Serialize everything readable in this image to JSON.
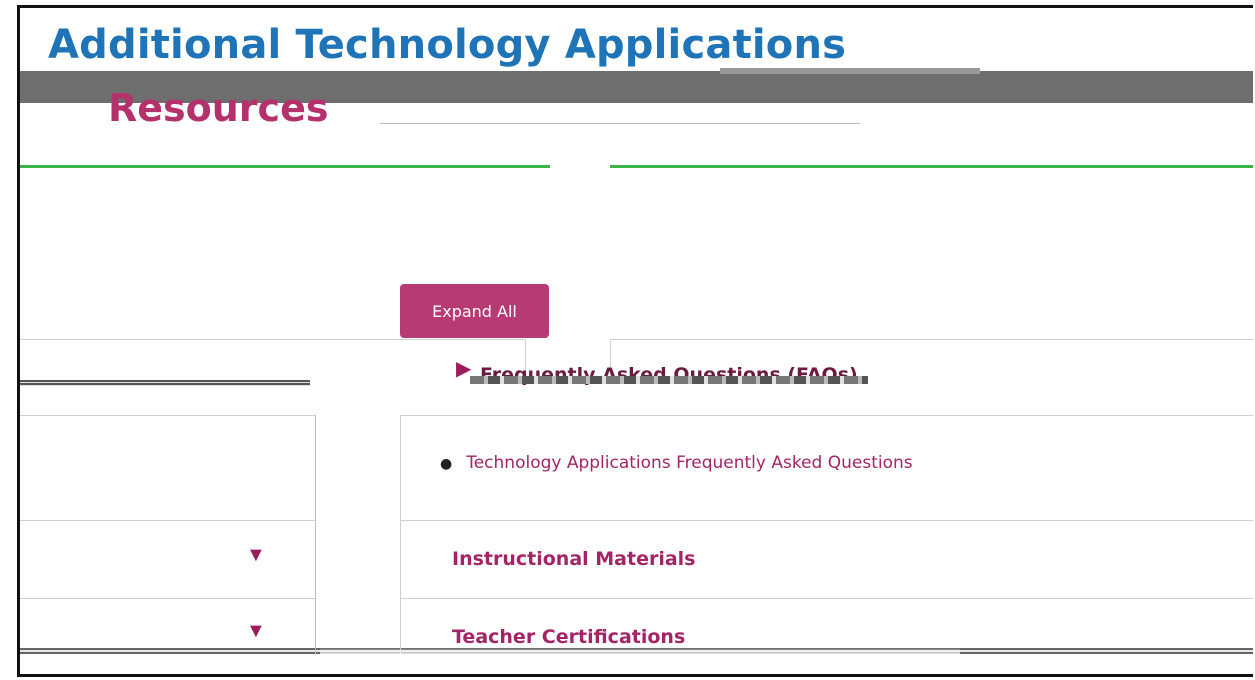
{
  "page": {
    "title": "Additional Technology Applications",
    "subtitle": "Resources"
  },
  "toolbar": {
    "expand_all_label": "Expand All"
  },
  "accordion": {
    "faq": {
      "title": "Frequently Asked Questions (FAQs)",
      "items": [
        "Technology Applications Frequently Asked Questions"
      ]
    },
    "sections": [
      {
        "title": "Instructional Materials"
      },
      {
        "title": "Teacher Certifications"
      }
    ]
  },
  "icons": {
    "expanded": "triangle-right-icon",
    "collapsed": "triangle-down-icon"
  },
  "colors": {
    "title_blue": "#1f73b7",
    "brand_magenta": "#b5316c",
    "button_bg": "#b83a74",
    "accent_green": "#3bb54a"
  }
}
